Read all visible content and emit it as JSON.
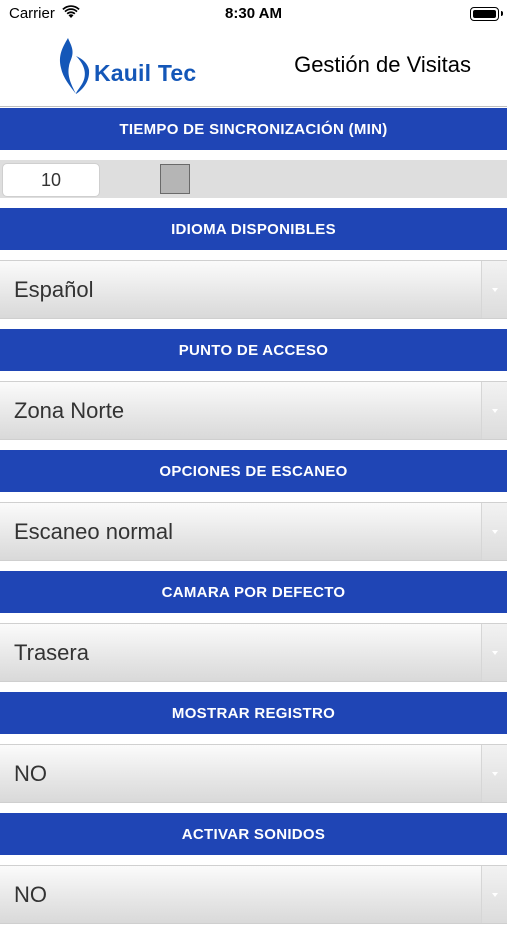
{
  "status_bar": {
    "carrier": "Carrier",
    "time": "8:30 AM"
  },
  "header": {
    "logo_text": "Kauil Tec",
    "title": "Gestión de Visitas"
  },
  "colors": {
    "section_header_bg": "#1f45b5",
    "logo_blue": "#1457b8"
  },
  "sync": {
    "header": "TIEMPO DE SINCRONIZACIÓN (MIN)",
    "value": "10"
  },
  "sections": [
    {
      "header": "IDIOMA DISPONIBLES",
      "value": "Español"
    },
    {
      "header": "PUNTO DE ACCESO",
      "value": "Zona Norte"
    },
    {
      "header": "OPCIONES DE ESCANEO",
      "value": "Escaneo normal"
    },
    {
      "header": "CAMARA POR DEFECTO",
      "value": "Trasera"
    },
    {
      "header": "MOSTRAR REGISTRO",
      "value": "NO"
    },
    {
      "header": "ACTIVAR SONIDOS",
      "value": "NO"
    }
  ]
}
